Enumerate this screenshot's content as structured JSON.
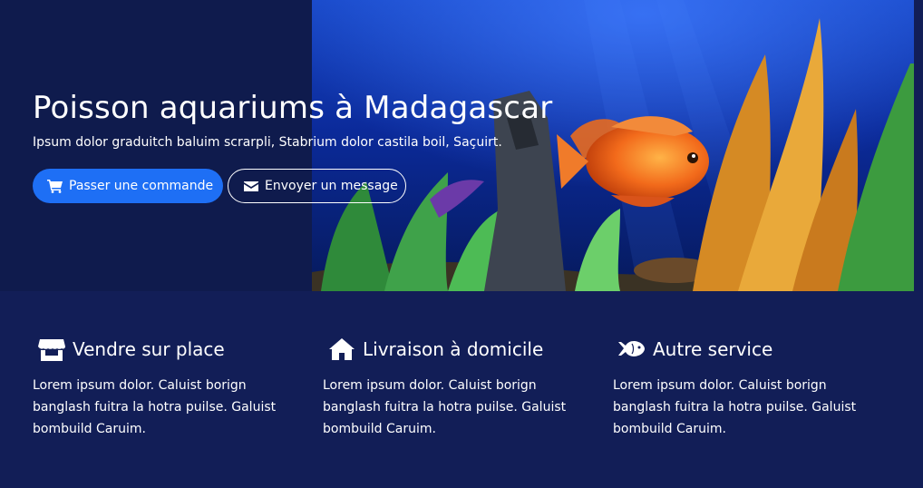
{
  "hero": {
    "title": "Poisson aquariums à Madagascar",
    "subtitle": "Ipsum dolor graduitch baluim scrarpli, Stabrium dolor castila boil, Saçuirt.",
    "primary_button": {
      "label": "Passer une commande",
      "icon": "cart-icon"
    },
    "secondary_button": {
      "label": "Envoyer un message",
      "icon": "envelope-icon"
    },
    "image": "aquarium-fish-photo"
  },
  "features": [
    {
      "icon": "store-icon",
      "title": "Vendre sur place",
      "text": "Lorem ipsum dolor. Caluist borign banglash fuitra la hotra puilse. Galuist bombuild Caruim."
    },
    {
      "icon": "home-icon",
      "title": "Livraison à domicile",
      "text": "Lorem ipsum dolor. Caluist borign banglash fuitra la hotra puilse. Galuist bombuild Caruim."
    },
    {
      "icon": "fish-icon",
      "title": "Autre service",
      "text": "Lorem ipsum dolor. Caluist borign banglash fuitra la hotra puilse. Galuist bombuild Caruim."
    }
  ],
  "colors": {
    "page_background": "#121e57",
    "hero_background": "#0f1b4d",
    "primary_button": "#1e6ff5",
    "text": "#ffffff"
  }
}
